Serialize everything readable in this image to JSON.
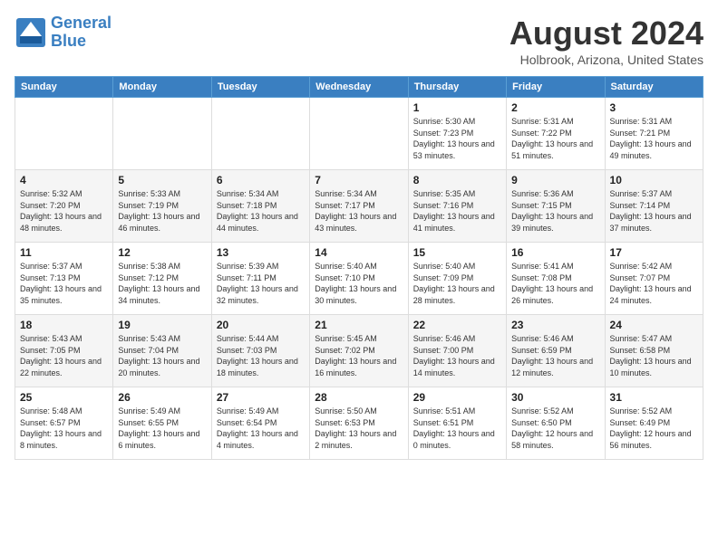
{
  "logo": {
    "line1": "General",
    "line2": "Blue"
  },
  "title": "August 2024",
  "location": "Holbrook, Arizona, United States",
  "days_of_week": [
    "Sunday",
    "Monday",
    "Tuesday",
    "Wednesday",
    "Thursday",
    "Friday",
    "Saturday"
  ],
  "weeks": [
    [
      {
        "day": "",
        "info": ""
      },
      {
        "day": "",
        "info": ""
      },
      {
        "day": "",
        "info": ""
      },
      {
        "day": "",
        "info": ""
      },
      {
        "day": "1",
        "info": "Sunrise: 5:30 AM\nSunset: 7:23 PM\nDaylight: 13 hours\nand 53 minutes."
      },
      {
        "day": "2",
        "info": "Sunrise: 5:31 AM\nSunset: 7:22 PM\nDaylight: 13 hours\nand 51 minutes."
      },
      {
        "day": "3",
        "info": "Sunrise: 5:31 AM\nSunset: 7:21 PM\nDaylight: 13 hours\nand 49 minutes."
      }
    ],
    [
      {
        "day": "4",
        "info": "Sunrise: 5:32 AM\nSunset: 7:20 PM\nDaylight: 13 hours\nand 48 minutes."
      },
      {
        "day": "5",
        "info": "Sunrise: 5:33 AM\nSunset: 7:19 PM\nDaylight: 13 hours\nand 46 minutes."
      },
      {
        "day": "6",
        "info": "Sunrise: 5:34 AM\nSunset: 7:18 PM\nDaylight: 13 hours\nand 44 minutes."
      },
      {
        "day": "7",
        "info": "Sunrise: 5:34 AM\nSunset: 7:17 PM\nDaylight: 13 hours\nand 43 minutes."
      },
      {
        "day": "8",
        "info": "Sunrise: 5:35 AM\nSunset: 7:16 PM\nDaylight: 13 hours\nand 41 minutes."
      },
      {
        "day": "9",
        "info": "Sunrise: 5:36 AM\nSunset: 7:15 PM\nDaylight: 13 hours\nand 39 minutes."
      },
      {
        "day": "10",
        "info": "Sunrise: 5:37 AM\nSunset: 7:14 PM\nDaylight: 13 hours\nand 37 minutes."
      }
    ],
    [
      {
        "day": "11",
        "info": "Sunrise: 5:37 AM\nSunset: 7:13 PM\nDaylight: 13 hours\nand 35 minutes."
      },
      {
        "day": "12",
        "info": "Sunrise: 5:38 AM\nSunset: 7:12 PM\nDaylight: 13 hours\nand 34 minutes."
      },
      {
        "day": "13",
        "info": "Sunrise: 5:39 AM\nSunset: 7:11 PM\nDaylight: 13 hours\nand 32 minutes."
      },
      {
        "day": "14",
        "info": "Sunrise: 5:40 AM\nSunset: 7:10 PM\nDaylight: 13 hours\nand 30 minutes."
      },
      {
        "day": "15",
        "info": "Sunrise: 5:40 AM\nSunset: 7:09 PM\nDaylight: 13 hours\nand 28 minutes."
      },
      {
        "day": "16",
        "info": "Sunrise: 5:41 AM\nSunset: 7:08 PM\nDaylight: 13 hours\nand 26 minutes."
      },
      {
        "day": "17",
        "info": "Sunrise: 5:42 AM\nSunset: 7:07 PM\nDaylight: 13 hours\nand 24 minutes."
      }
    ],
    [
      {
        "day": "18",
        "info": "Sunrise: 5:43 AM\nSunset: 7:05 PM\nDaylight: 13 hours\nand 22 minutes."
      },
      {
        "day": "19",
        "info": "Sunrise: 5:43 AM\nSunset: 7:04 PM\nDaylight: 13 hours\nand 20 minutes."
      },
      {
        "day": "20",
        "info": "Sunrise: 5:44 AM\nSunset: 7:03 PM\nDaylight: 13 hours\nand 18 minutes."
      },
      {
        "day": "21",
        "info": "Sunrise: 5:45 AM\nSunset: 7:02 PM\nDaylight: 13 hours\nand 16 minutes."
      },
      {
        "day": "22",
        "info": "Sunrise: 5:46 AM\nSunset: 7:00 PM\nDaylight: 13 hours\nand 14 minutes."
      },
      {
        "day": "23",
        "info": "Sunrise: 5:46 AM\nSunset: 6:59 PM\nDaylight: 13 hours\nand 12 minutes."
      },
      {
        "day": "24",
        "info": "Sunrise: 5:47 AM\nSunset: 6:58 PM\nDaylight: 13 hours\nand 10 minutes."
      }
    ],
    [
      {
        "day": "25",
        "info": "Sunrise: 5:48 AM\nSunset: 6:57 PM\nDaylight: 13 hours\nand 8 minutes."
      },
      {
        "day": "26",
        "info": "Sunrise: 5:49 AM\nSunset: 6:55 PM\nDaylight: 13 hours\nand 6 minutes."
      },
      {
        "day": "27",
        "info": "Sunrise: 5:49 AM\nSunset: 6:54 PM\nDaylight: 13 hours\nand 4 minutes."
      },
      {
        "day": "28",
        "info": "Sunrise: 5:50 AM\nSunset: 6:53 PM\nDaylight: 13 hours\nand 2 minutes."
      },
      {
        "day": "29",
        "info": "Sunrise: 5:51 AM\nSunset: 6:51 PM\nDaylight: 13 hours\nand 0 minutes."
      },
      {
        "day": "30",
        "info": "Sunrise: 5:52 AM\nSunset: 6:50 PM\nDaylight: 12 hours\nand 58 minutes."
      },
      {
        "day": "31",
        "info": "Sunrise: 5:52 AM\nSunset: 6:49 PM\nDaylight: 12 hours\nand 56 minutes."
      }
    ]
  ]
}
